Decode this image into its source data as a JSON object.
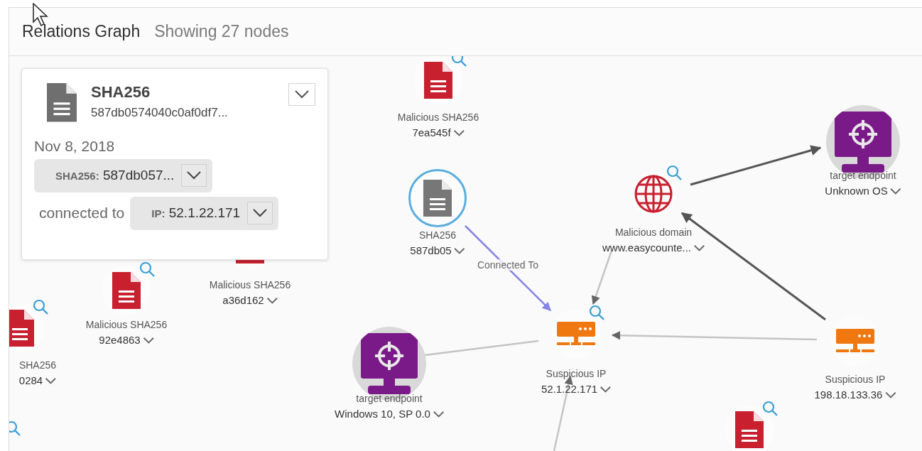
{
  "header": {
    "title": "Relations Graph",
    "subtitle": "Showing 27 nodes"
  },
  "detail_card": {
    "type_label": "SHA256",
    "hash": "587db0574040c0af0df7...",
    "date": "Nov 8, 2018",
    "source": {
      "prefix": "SHA256:",
      "value": "587db057..."
    },
    "relation": "connected to",
    "target": {
      "prefix": "IP:",
      "value": "52.1.22.171"
    }
  },
  "graph": {
    "nodes": [
      {
        "kind": "file",
        "malicious": true,
        "label": "Malicious SHA256",
        "value": "7ea545f",
        "searchable": true,
        "selected": false
      },
      {
        "kind": "file",
        "malicious": false,
        "label": "SHA256",
        "value": "587db05",
        "searchable": false,
        "selected": true
      },
      {
        "kind": "domain",
        "malicious": true,
        "label": "Malicious domain",
        "value": "www.easycounte...",
        "searchable": true,
        "selected": false
      },
      {
        "kind": "endpoint",
        "label": "target endpoint",
        "value": "Unknown OS",
        "searchable": false,
        "selected": false
      },
      {
        "kind": "file",
        "malicious": true,
        "label": "Malicious SHA256",
        "value": "a36d162",
        "searchable": false,
        "selected": false
      },
      {
        "kind": "file",
        "malicious": true,
        "label": "Malicious SHA256",
        "value": "92e4863",
        "searchable": true,
        "selected": false
      },
      {
        "kind": "file",
        "malicious": true,
        "label": "SHA256",
        "value": "0284",
        "searchable": true,
        "selected": false
      },
      {
        "kind": "ip",
        "label": "Suspicious IP",
        "value": "52.1.22.171",
        "searchable": true,
        "selected": false
      },
      {
        "kind": "endpoint",
        "label": "target endpoint",
        "value": "Windows 10, SP 0.0",
        "searchable": false,
        "selected": false
      },
      {
        "kind": "ip",
        "label": "Suspicious IP",
        "value": "198.18.133.36",
        "searchable": false,
        "selected": false
      },
      {
        "kind": "file",
        "malicious": true,
        "searchable": true,
        "selected": false
      },
      {
        "kind": "offscreen",
        "searchable": true
      }
    ],
    "edges": [
      {
        "kind": "highlight",
        "label": "Connected To",
        "arrow": true
      },
      {
        "kind": "light",
        "arrow": true
      },
      {
        "kind": "strong",
        "arrow": true
      },
      {
        "kind": "strong",
        "arrow": true
      },
      {
        "kind": "light",
        "arrow": true
      },
      {
        "kind": "light",
        "arrow": false
      },
      {
        "kind": "light",
        "arrow": true
      }
    ]
  }
}
